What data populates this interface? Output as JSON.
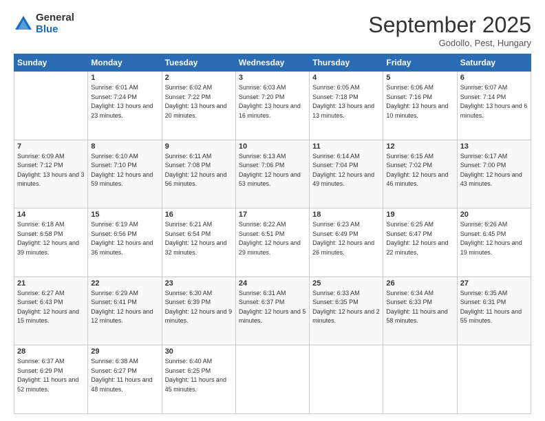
{
  "logo": {
    "general": "General",
    "blue": "Blue"
  },
  "title": "September 2025",
  "location": "Godollo, Pest, Hungary",
  "days_header": [
    "Sunday",
    "Monday",
    "Tuesday",
    "Wednesday",
    "Thursday",
    "Friday",
    "Saturday"
  ],
  "weeks": [
    [
      {
        "day": "",
        "sunrise": "",
        "sunset": "",
        "daylight": ""
      },
      {
        "day": "1",
        "sunrise": "Sunrise: 6:01 AM",
        "sunset": "Sunset: 7:24 PM",
        "daylight": "Daylight: 13 hours and 23 minutes."
      },
      {
        "day": "2",
        "sunrise": "Sunrise: 6:02 AM",
        "sunset": "Sunset: 7:22 PM",
        "daylight": "Daylight: 13 hours and 20 minutes."
      },
      {
        "day": "3",
        "sunrise": "Sunrise: 6:03 AM",
        "sunset": "Sunset: 7:20 PM",
        "daylight": "Daylight: 13 hours and 16 minutes."
      },
      {
        "day": "4",
        "sunrise": "Sunrise: 6:05 AM",
        "sunset": "Sunset: 7:18 PM",
        "daylight": "Daylight: 13 hours and 13 minutes."
      },
      {
        "day": "5",
        "sunrise": "Sunrise: 6:06 AM",
        "sunset": "Sunset: 7:16 PM",
        "daylight": "Daylight: 13 hours and 10 minutes."
      },
      {
        "day": "6",
        "sunrise": "Sunrise: 6:07 AM",
        "sunset": "Sunset: 7:14 PM",
        "daylight": "Daylight: 13 hours and 6 minutes."
      }
    ],
    [
      {
        "day": "7",
        "sunrise": "Sunrise: 6:09 AM",
        "sunset": "Sunset: 7:12 PM",
        "daylight": "Daylight: 13 hours and 3 minutes."
      },
      {
        "day": "8",
        "sunrise": "Sunrise: 6:10 AM",
        "sunset": "Sunset: 7:10 PM",
        "daylight": "Daylight: 12 hours and 59 minutes."
      },
      {
        "day": "9",
        "sunrise": "Sunrise: 6:11 AM",
        "sunset": "Sunset: 7:08 PM",
        "daylight": "Daylight: 12 hours and 56 minutes."
      },
      {
        "day": "10",
        "sunrise": "Sunrise: 6:13 AM",
        "sunset": "Sunset: 7:06 PM",
        "daylight": "Daylight: 12 hours and 53 minutes."
      },
      {
        "day": "11",
        "sunrise": "Sunrise: 6:14 AM",
        "sunset": "Sunset: 7:04 PM",
        "daylight": "Daylight: 12 hours and 49 minutes."
      },
      {
        "day": "12",
        "sunrise": "Sunrise: 6:15 AM",
        "sunset": "Sunset: 7:02 PM",
        "daylight": "Daylight: 12 hours and 46 minutes."
      },
      {
        "day": "13",
        "sunrise": "Sunrise: 6:17 AM",
        "sunset": "Sunset: 7:00 PM",
        "daylight": "Daylight: 12 hours and 43 minutes."
      }
    ],
    [
      {
        "day": "14",
        "sunrise": "Sunrise: 6:18 AM",
        "sunset": "Sunset: 6:58 PM",
        "daylight": "Daylight: 12 hours and 39 minutes."
      },
      {
        "day": "15",
        "sunrise": "Sunrise: 6:19 AM",
        "sunset": "Sunset: 6:56 PM",
        "daylight": "Daylight: 12 hours and 36 minutes."
      },
      {
        "day": "16",
        "sunrise": "Sunrise: 6:21 AM",
        "sunset": "Sunset: 6:54 PM",
        "daylight": "Daylight: 12 hours and 32 minutes."
      },
      {
        "day": "17",
        "sunrise": "Sunrise: 6:22 AM",
        "sunset": "Sunset: 6:51 PM",
        "daylight": "Daylight: 12 hours and 29 minutes."
      },
      {
        "day": "18",
        "sunrise": "Sunrise: 6:23 AM",
        "sunset": "Sunset: 6:49 PM",
        "daylight": "Daylight: 12 hours and 26 minutes."
      },
      {
        "day": "19",
        "sunrise": "Sunrise: 6:25 AM",
        "sunset": "Sunset: 6:47 PM",
        "daylight": "Daylight: 12 hours and 22 minutes."
      },
      {
        "day": "20",
        "sunrise": "Sunrise: 6:26 AM",
        "sunset": "Sunset: 6:45 PM",
        "daylight": "Daylight: 12 hours and 19 minutes."
      }
    ],
    [
      {
        "day": "21",
        "sunrise": "Sunrise: 6:27 AM",
        "sunset": "Sunset: 6:43 PM",
        "daylight": "Daylight: 12 hours and 15 minutes."
      },
      {
        "day": "22",
        "sunrise": "Sunrise: 6:29 AM",
        "sunset": "Sunset: 6:41 PM",
        "daylight": "Daylight: 12 hours and 12 minutes."
      },
      {
        "day": "23",
        "sunrise": "Sunrise: 6:30 AM",
        "sunset": "Sunset: 6:39 PM",
        "daylight": "Daylight: 12 hours and 9 minutes."
      },
      {
        "day": "24",
        "sunrise": "Sunrise: 6:31 AM",
        "sunset": "Sunset: 6:37 PM",
        "daylight": "Daylight: 12 hours and 5 minutes."
      },
      {
        "day": "25",
        "sunrise": "Sunrise: 6:33 AM",
        "sunset": "Sunset: 6:35 PM",
        "daylight": "Daylight: 12 hours and 2 minutes."
      },
      {
        "day": "26",
        "sunrise": "Sunrise: 6:34 AM",
        "sunset": "Sunset: 6:33 PM",
        "daylight": "Daylight: 11 hours and 58 minutes."
      },
      {
        "day": "27",
        "sunrise": "Sunrise: 6:35 AM",
        "sunset": "Sunset: 6:31 PM",
        "daylight": "Daylight: 11 hours and 55 minutes."
      }
    ],
    [
      {
        "day": "28",
        "sunrise": "Sunrise: 6:37 AM",
        "sunset": "Sunset: 6:29 PM",
        "daylight": "Daylight: 11 hours and 52 minutes."
      },
      {
        "day": "29",
        "sunrise": "Sunrise: 6:38 AM",
        "sunset": "Sunset: 6:27 PM",
        "daylight": "Daylight: 11 hours and 48 minutes."
      },
      {
        "day": "30",
        "sunrise": "Sunrise: 6:40 AM",
        "sunset": "Sunset: 6:25 PM",
        "daylight": "Daylight: 11 hours and 45 minutes."
      },
      {
        "day": "",
        "sunrise": "",
        "sunset": "",
        "daylight": ""
      },
      {
        "day": "",
        "sunrise": "",
        "sunset": "",
        "daylight": ""
      },
      {
        "day": "",
        "sunrise": "",
        "sunset": "",
        "daylight": ""
      },
      {
        "day": "",
        "sunrise": "",
        "sunset": "",
        "daylight": ""
      }
    ]
  ]
}
